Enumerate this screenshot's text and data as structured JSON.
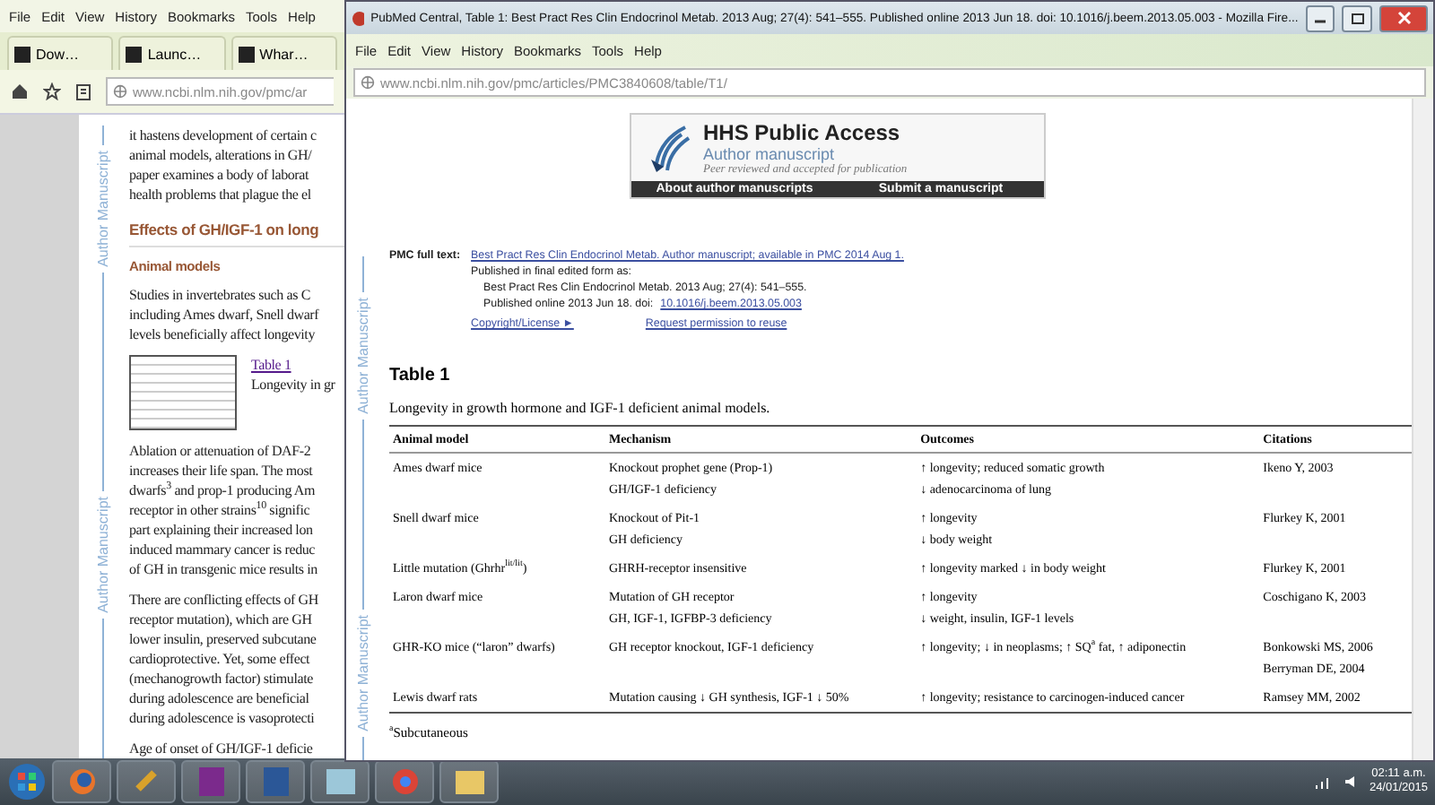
{
  "background_window": {
    "menu": [
      "File",
      "Edit",
      "View",
      "History",
      "Bookmarks",
      "Tools",
      "Help"
    ],
    "tabs": [
      {
        "label": "Dow…"
      },
      {
        "label": "Launc…"
      },
      {
        "label": "Whar…"
      }
    ],
    "address": "www.ncbi.nlm.nih.gov/pmc/ar",
    "margin_labels": [
      "Author Manuscript",
      "Author Manuscript"
    ],
    "blocks": [
      {
        "kind": "paragraph",
        "lines": [
          "it hastens development of certain c",
          "animal models, alterations in GH/",
          "paper examines a body of laborat",
          "health problems that plague the el"
        ]
      },
      {
        "kind": "heading",
        "text": "Effects of GH/IGF-1 on long"
      },
      {
        "kind": "subheading",
        "text": "Animal models"
      },
      {
        "kind": "paragraph",
        "lines": [
          "Studies in invertebrates such as C",
          "including Ames dwarf, Snell dwarf",
          "levels beneficially affect longevity"
        ]
      },
      {
        "kind": "figure",
        "link": "Table 1",
        "caption": "Longevity in gr"
      },
      {
        "kind": "paragraph",
        "lines": [
          "Ablation or attenuation of DAF-2",
          "increases their life span. The most",
          "dwarfs$^{3}$ and prop-1 producing Am",
          "receptor in other strains$^{10}$ signific",
          "part explaining their increased lon",
          "induced mammary cancer is reduc",
          "of GH in transgenic mice results in"
        ]
      },
      {
        "kind": "paragraph",
        "lines": [
          "There are conflicting effects of GH",
          "receptor mutation), which are GH",
          "lower insulin, preserved subcutane",
          "cardioprotective. Yet, some effect",
          "(mechanogrowth factor) stimulate",
          "during adolescence are beneficial",
          "during adolescence is vasoprotecti"
        ]
      },
      {
        "kind": "paragraph",
        "lines": [
          "Age of onset of GH/IGF-1 deficie"
        ]
      }
    ]
  },
  "popup_window": {
    "title": "PubMed Central, Table 1: Best Pract Res Clin Endocrinol Metab. 2013 Aug; 27(4): 541–555. Published online 2013 Jun 18. doi:  10.1016/j.beem.2013.05.003 - Mozilla Fire...",
    "menu": [
      "File",
      "Edit",
      "View",
      "History",
      "Bookmarks",
      "Tools",
      "Help"
    ],
    "address": "www.ncbi.nlm.nih.gov/pmc/articles/PMC3840608/table/T1/",
    "banner": {
      "title": "HHS Public Access",
      "subtitle": "Author manuscript",
      "note": "Peer reviewed and accepted for publication",
      "links": [
        "About author manuscripts",
        "Submit a manuscript"
      ]
    },
    "citation": {
      "label": "PMC full text:",
      "link": "Best Pract Res Clin Endocrinol Metab. Author manuscript; available in PMC 2014 Aug 1.",
      "published_label": "Published in final edited form as:",
      "journal": "Best Pract Res Clin Endocrinol Metab. 2013 Aug; 27(4): 541–555.",
      "online": "Published online 2013 Jun 18. doi:",
      "doi": "10.1016/j.beem.2013.05.003",
      "copyright": "Copyright/License ►",
      "permission": "Request permission to reuse"
    },
    "margin_labels": [
      "Author Manuscript",
      "Author Manuscript"
    ],
    "table": {
      "title": "Table 1",
      "caption": "Longevity in growth hormone and IGF-1 deficient animal models.",
      "columns": [
        "Animal model",
        "Mechanism",
        "Outcomes",
        "Citations"
      ],
      "rows": [
        {
          "cells": [
            [
              "Ames dwarf mice"
            ],
            [
              "Knockout prophet gene (Prop-1)",
              "GH/IGF-1 deficiency"
            ],
            [
              "↑ longevity; reduced somatic growth",
              "↓ adenocarcinoma of lung"
            ],
            [
              "Ikeno Y, 2003"
            ]
          ]
        },
        {
          "cells": [
            [
              "Snell dwarf mice"
            ],
            [
              "Knockout of Pit-1",
              "GH deficiency"
            ],
            [
              "↑ longevity",
              "↓ body weight"
            ],
            [
              "Flurkey K, 2001"
            ]
          ]
        },
        {
          "cells": [
            [
              "Little mutation (Ghrhr$^{lit/lit}$)"
            ],
            [
              "GHRH-receptor insensitive"
            ],
            [
              "↑ longevity marked ↓ in body weight"
            ],
            [
              "Flurkey K, 2001"
            ]
          ]
        },
        {
          "cells": [
            [
              "Laron dwarf mice"
            ],
            [
              "Mutation of GH receptor",
              "GH, IGF-1, IGFBP-3 deficiency"
            ],
            [
              "↑ longevity",
              "↓ weight, insulin, IGF-1 levels"
            ],
            [
              "Coschigano K, 2003"
            ]
          ]
        },
        {
          "cells": [
            [
              "GHR-KO mice (“laron” dwarfs)"
            ],
            [
              "GH receptor knockout, IGF-1 deficiency"
            ],
            [
              "↑ longevity; ↓ in neoplasms; ↑ SQ$^{a}$ fat, ↑ adiponectin"
            ],
            [
              "Bonkowski MS, 2006",
              "Berryman DE, 2004"
            ]
          ]
        },
        {
          "cells": [
            [
              "Lewis dwarf rats"
            ],
            [
              "Mutation causing ↓ GH synthesis, IGF-1 ↓ 50%"
            ],
            [
              "↑ longevity; resistance to carcinogen-induced cancer"
            ],
            [
              "Ramsey MM, 2002"
            ]
          ]
        }
      ],
      "footnote": "$^{a}$Subcutaneous"
    }
  },
  "taskbar": {
    "time": "02:11 a.m.",
    "date": "24/01/2015"
  }
}
